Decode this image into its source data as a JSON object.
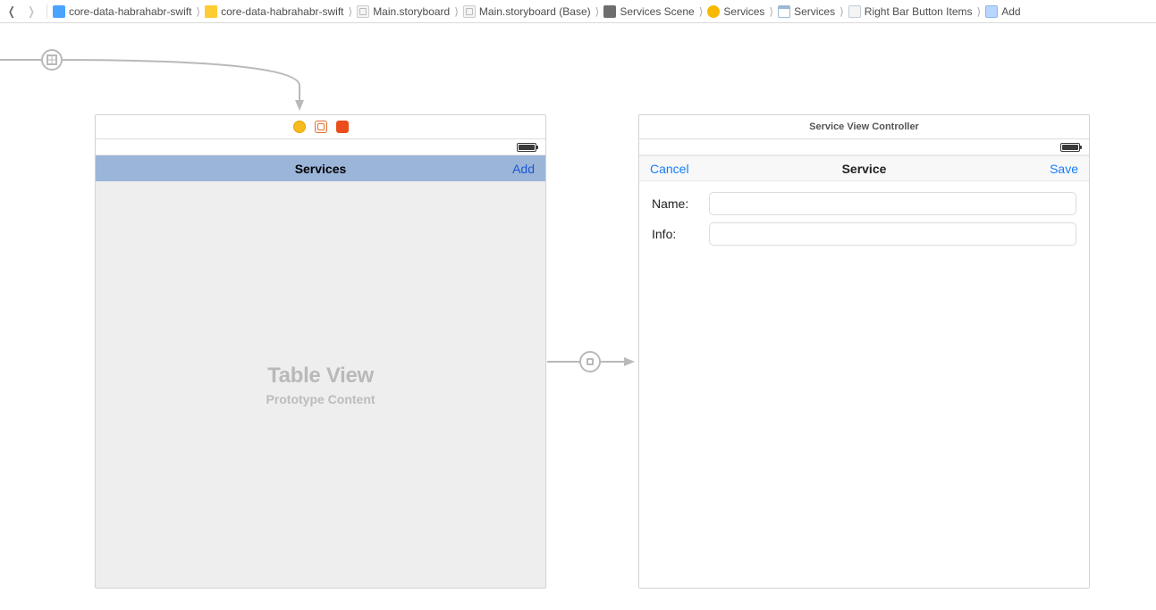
{
  "breadcrumb": {
    "back_enabled": true,
    "forward_enabled": false,
    "items": [
      {
        "icon": "swift-doc-icon",
        "label": "core-data-habrahabr-swift"
      },
      {
        "icon": "folder-icon",
        "label": "core-data-habrahabr-swift"
      },
      {
        "icon": "storyboard-icon",
        "label": "Main.storyboard"
      },
      {
        "icon": "storyboard-icon",
        "label": "Main.storyboard (Base)"
      },
      {
        "icon": "scene-icon",
        "label": "Services Scene"
      },
      {
        "icon": "controller-icon",
        "label": "Services"
      },
      {
        "icon": "view-icon",
        "label": "Services"
      },
      {
        "icon": "barbuttons-icon",
        "label": "Right Bar Button Items"
      },
      {
        "icon": "add-glyph-icon",
        "label": "Add"
      }
    ]
  },
  "scenes": {
    "services": {
      "header_title": "",
      "nav_title": "Services",
      "nav_right": "Add",
      "tableview_title": "Table View",
      "tableview_subtitle": "Prototype Content"
    },
    "service_form": {
      "header_title": "Service View Controller",
      "nav_left": "Cancel",
      "nav_title": "Service",
      "nav_right": "Save",
      "fields": {
        "name_label": "Name:",
        "name_value": "",
        "info_label": "Info:",
        "info_value": ""
      }
    }
  }
}
